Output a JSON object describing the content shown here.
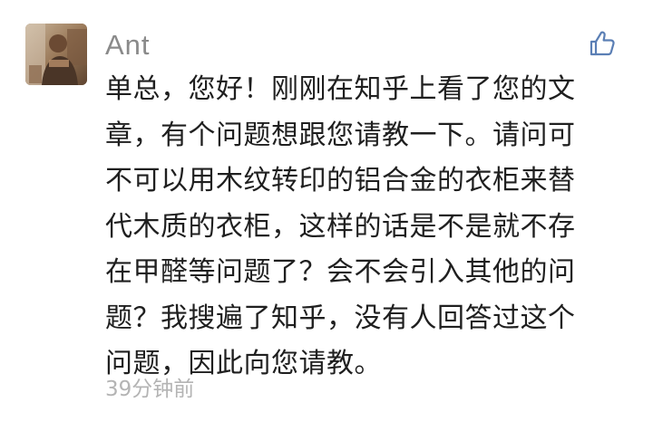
{
  "comment": {
    "username": "Ant",
    "lines": [
      "单总，您好！刚刚在知乎上看了您的文",
      "章，有个问题想跟您请教一下。请问可",
      "不可以用木纹转印的铝合金的衣柜来替",
      "代木质的衣柜，这样的话是不是就不存",
      "在甲醛等问题了？会不会引入其他的问",
      "题？我搜遍了知乎，没有人回答过这个",
      "问题，因此向您请教。"
    ],
    "timestamp": "39分钟前",
    "like_icon": "thumbs-up-icon",
    "avatar": "user-avatar-photo"
  },
  "colors": {
    "accent": "#5b7fb5",
    "username": "#8a8a8a",
    "text": "#1f1f1f",
    "timestamp": "#b4b4b4"
  }
}
